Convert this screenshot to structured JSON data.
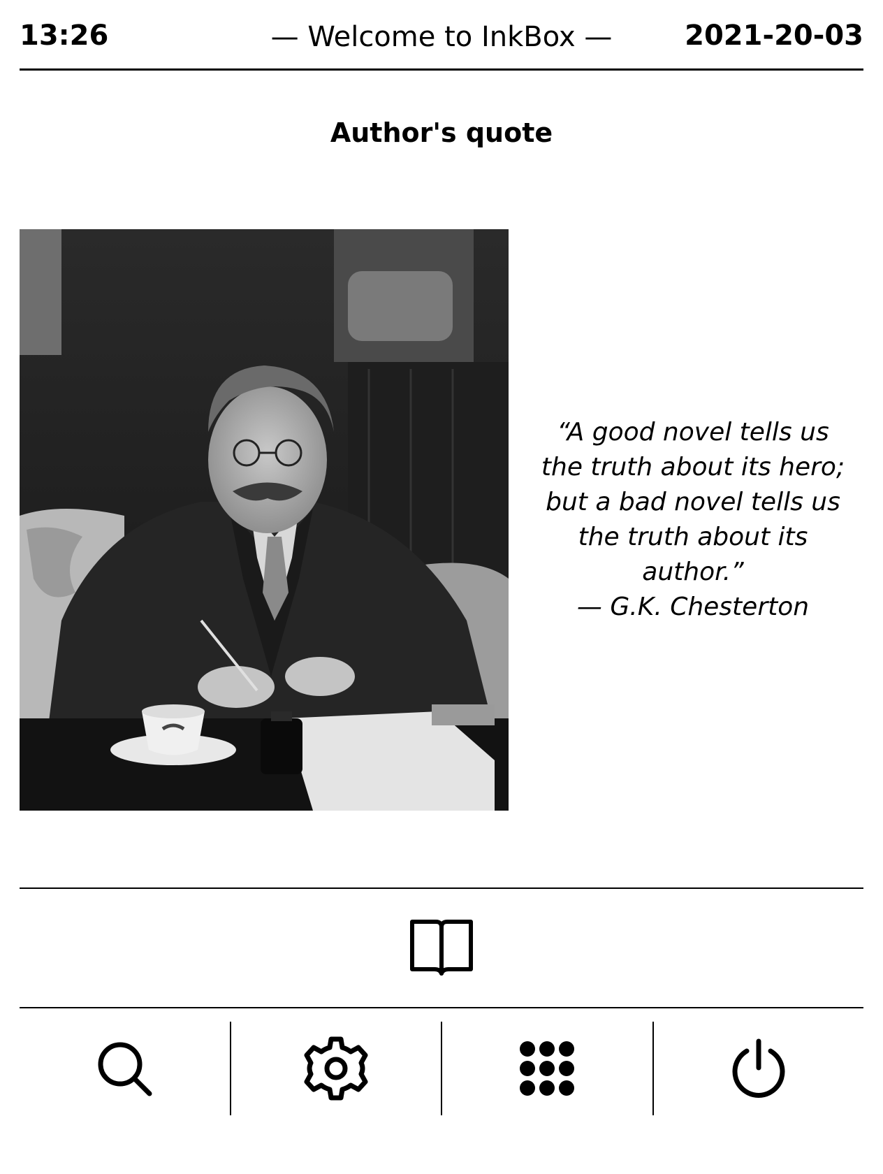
{
  "status_bar": {
    "time": "13:26",
    "welcome": "— Welcome to InkBox —",
    "date": "2021-20-03"
  },
  "heading": "Author's quote",
  "photo": {
    "alt": "Portrait of G.K. Chesterton writing at a desk"
  },
  "quote": {
    "lines": [
      "“A good novel tells us",
      "the truth about its hero;",
      "but a bad novel tells us",
      "the truth about its",
      "author.”"
    ],
    "author": "— G.K. Chesterton"
  },
  "reader_button": {
    "icon": "book-open-icon"
  },
  "bottom_bar": {
    "buttons": [
      {
        "icon": "search-icon"
      },
      {
        "icon": "gear-icon"
      },
      {
        "icon": "apps-grid-icon"
      },
      {
        "icon": "power-icon"
      }
    ]
  },
  "colors": {
    "foreground": "#000000",
    "background": "#ffffff"
  }
}
